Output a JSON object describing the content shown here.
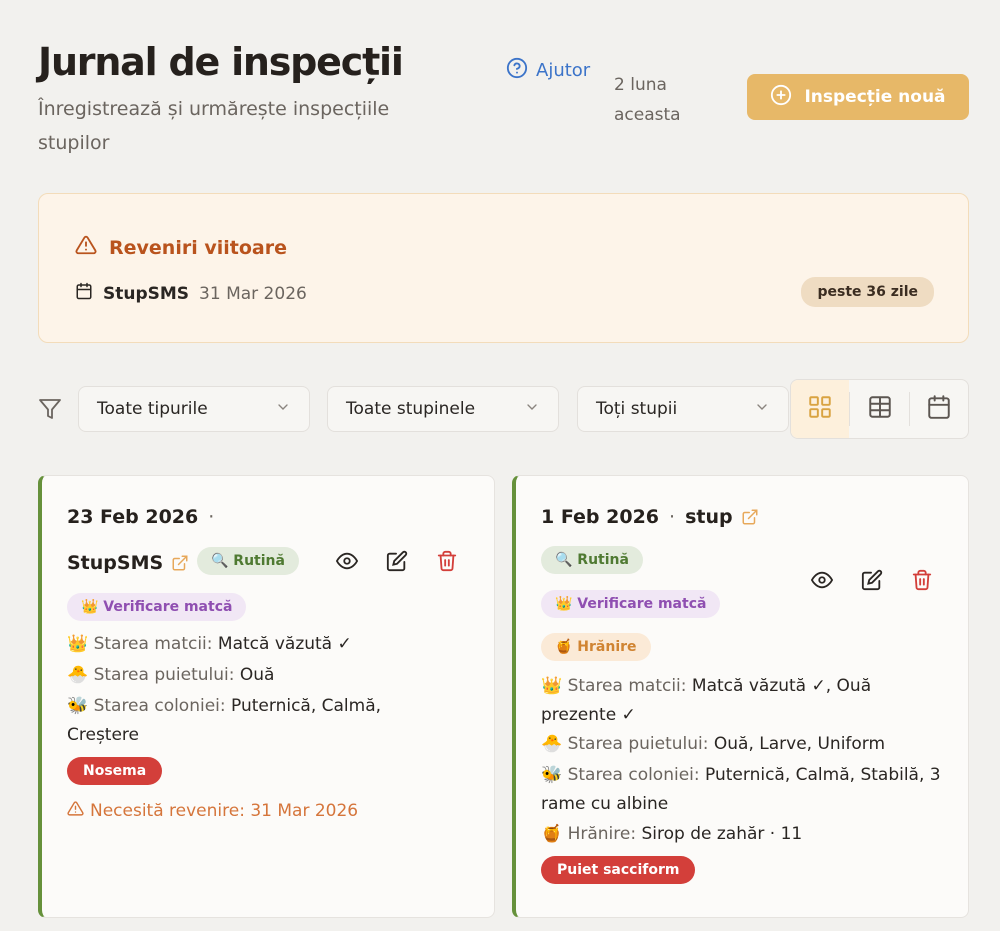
{
  "header": {
    "title": "Jurnal de inspecții",
    "subtitle": "Înregistrează și urmărește inspecțiile stupilor",
    "help_label": "Ajutor",
    "month_count": "2 luna aceasta",
    "new_button_label": "Inspecție nouă"
  },
  "upcoming": {
    "title": "Reveniri viitoare",
    "items": [
      {
        "hive": "StupSMS",
        "date": "31 Mar 2026",
        "badge": "peste 36 zile"
      }
    ]
  },
  "filters": {
    "type_select": "Toate tipurile",
    "apiary_select": "Toate stupinele",
    "hive_select": "Toți stupii",
    "views": [
      "grid",
      "table",
      "calendar"
    ],
    "active_view": "grid"
  },
  "cards": [
    {
      "date": "23 Feb 2026",
      "separator": "·",
      "hive": "StupSMS",
      "chips": {
        "routine": "🔍 Rutină",
        "queen": "👑 Verificare matcă"
      },
      "queen_label": "👑 Starea matcii:",
      "queen_value": "Matcă văzută ✓",
      "brood_label": "🐣 Starea puietului:",
      "brood_value": "Ouă",
      "colony_label": "🐝 Starea coloniei:",
      "colony_value": "Puternică, Calmă, Creștere",
      "disease": "Nosema",
      "followup": "Necesită revenire: 31 Mar 2026"
    },
    {
      "date": "1 Feb 2026",
      "separator": "·",
      "hive": "stup",
      "chips": {
        "routine": "🔍 Rutină",
        "queen": "👑 Verificare matcă",
        "feed": "🍯 Hrănire"
      },
      "queen_label": "👑 Starea matcii:",
      "queen_value": "Matcă văzută ✓, Ouă prezente ✓",
      "brood_label": "🐣 Starea puietului:",
      "brood_value": "Ouă, Larve, Uniform",
      "colony_label": "🐝 Starea coloniei:",
      "colony_value": "Puternică, Calmă, Stabilă, 3 rame cu albine",
      "feed_label": "🍯 Hrănire:",
      "feed_value": "Sirop de zahăr · 11",
      "disease": "Puiet sacciform"
    }
  ],
  "colors": {
    "accent": "#e7b868",
    "card_border": "#66913b",
    "danger": "#d33f3a",
    "warning": "#b9531d",
    "link": "#3c74c9"
  }
}
